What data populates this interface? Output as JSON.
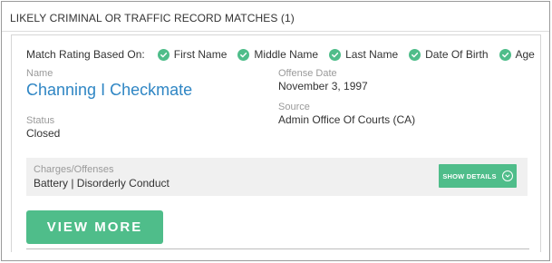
{
  "section": {
    "title": "LIKELY CRIMINAL OR TRAFFIC RECORD MATCHES (1)"
  },
  "match_rating": {
    "lead": "Match Rating Based On:",
    "items": [
      "First Name",
      "Middle Name",
      "Last Name",
      "Date Of Birth",
      "Age"
    ]
  },
  "record": {
    "name_label": "Name",
    "name_value": "Channing I Checkmate",
    "status_label": "Status",
    "status_value": "Closed",
    "offense_date_label": "Offense Date",
    "offense_date_value": "November 3, 1997",
    "source_label": "Source",
    "source_value": "Admin Office Of Courts (CA)",
    "charges_label": "Charges/Offenses",
    "charges_value": "Battery | Disorderly Conduct",
    "show_details_label": "SHOW DETAILS"
  },
  "actions": {
    "view_more_label": "VIEW MORE"
  },
  "colors": {
    "accent_green": "#4fbd8a",
    "name_blue": "#2f86c4"
  },
  "icons": {
    "match_check": "check-circle-icon",
    "show_details": "chevron-down-circle-icon"
  }
}
